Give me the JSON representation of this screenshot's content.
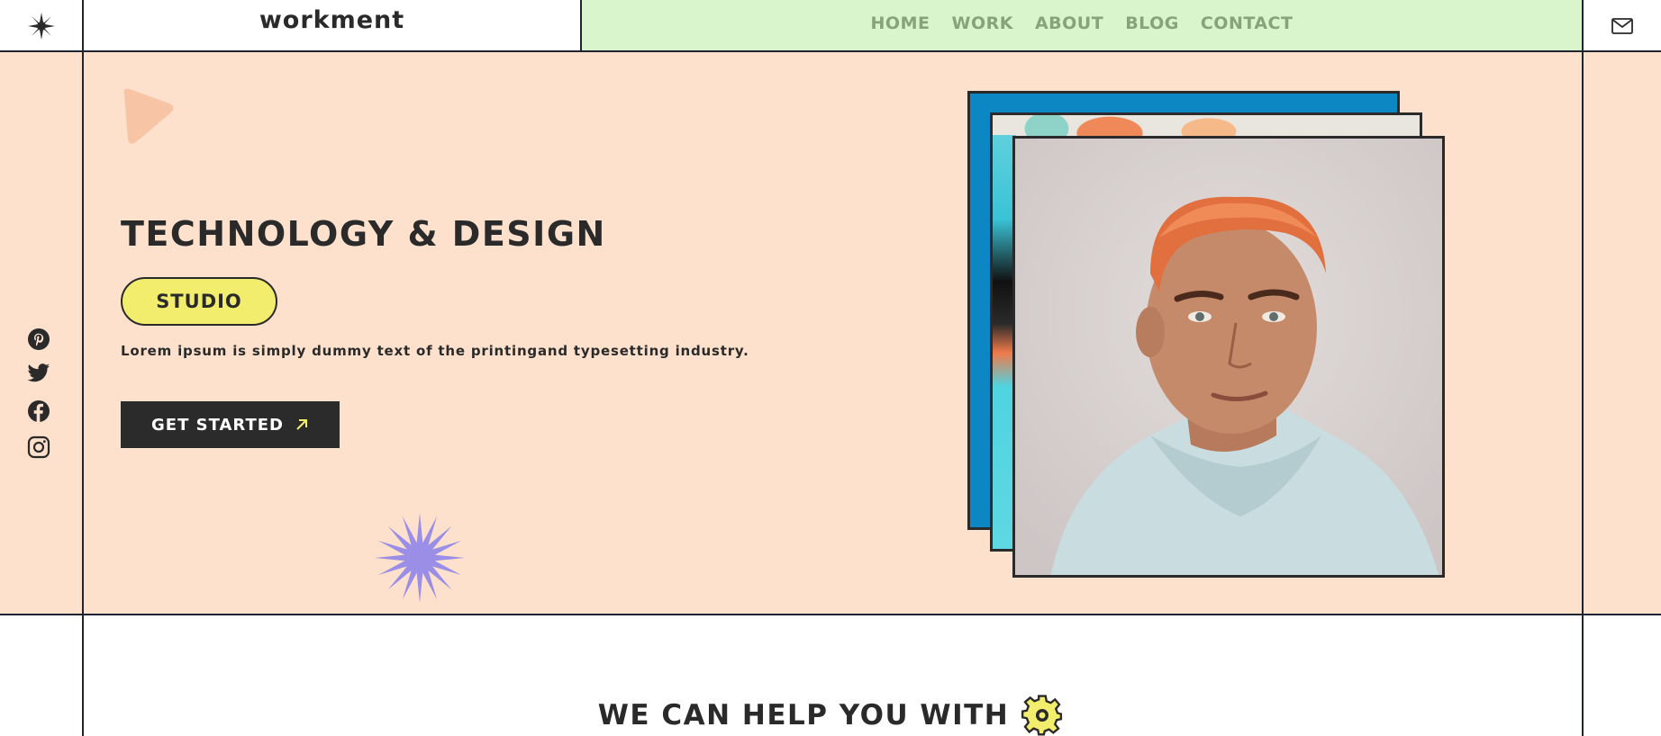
{
  "header": {
    "brand": "workment",
    "nav": [
      "HOME",
      "WORK",
      "ABOUT",
      "BLOG",
      "CONTACT"
    ],
    "nav_bg": "#d9f5cc",
    "nav_color": "#87a37b",
    "logo_icon": "starburst-logo-icon",
    "mail_icon": "mail-icon"
  },
  "hero": {
    "bg": "#fde1cc",
    "title": "TECHNOLOGY & DESIGN",
    "badge": "STUDIO",
    "badge_bg": "#f2ed6d",
    "description": "Lorem ipsum is simply dummy text of the printingand typesetting industry.",
    "cta": "GET STARTED",
    "social_icons": [
      "pinterest-icon",
      "twitter-icon",
      "facebook-icon",
      "instagram-icon"
    ]
  },
  "services": {
    "title": "WE CAN HELP YOU WITH"
  }
}
